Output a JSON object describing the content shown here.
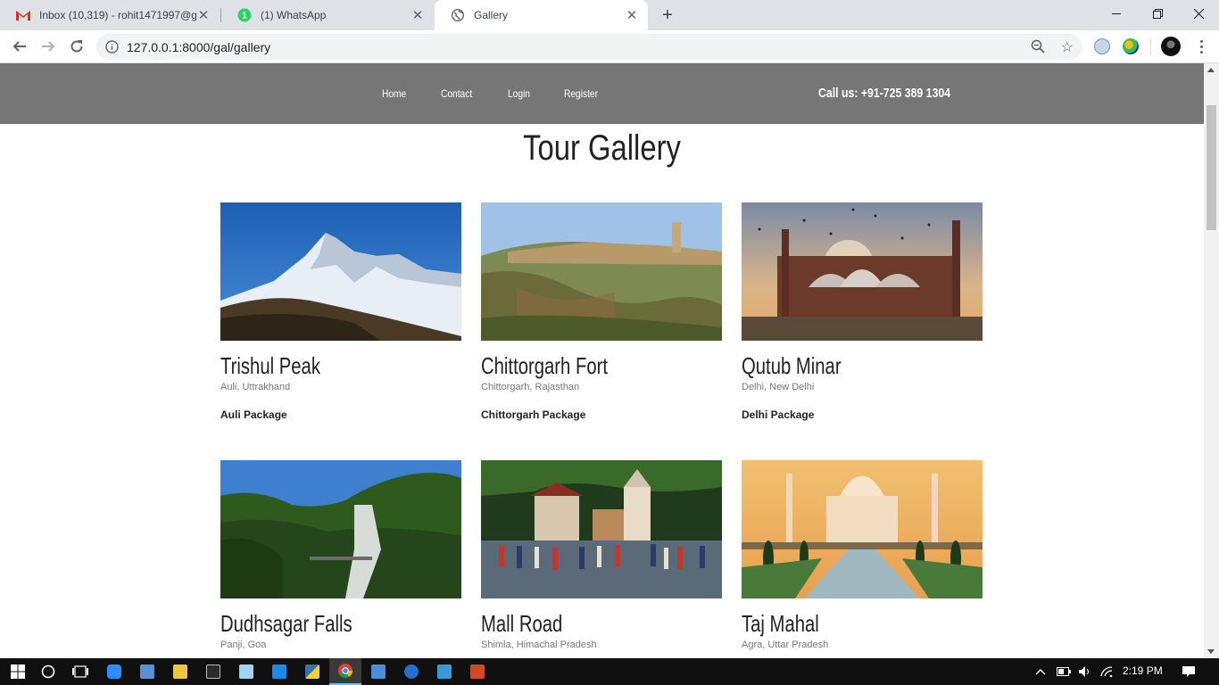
{
  "browser": {
    "tabs": [
      {
        "title": "Inbox (10,319) - rohit1471997@g",
        "icon": "gmail-icon"
      },
      {
        "title": "(1) WhatsApp",
        "icon": "whatsapp-icon",
        "badge": "1"
      },
      {
        "title": "Gallery",
        "icon": "globe-icon",
        "active": true
      }
    ],
    "url": "127.0.0.1:8000/gal/gallery"
  },
  "site": {
    "nav": {
      "items": [
        "Home",
        "Contact",
        "Login",
        "Register"
      ],
      "call": "Call us: +91-725 389 1304"
    },
    "title": "Tour Gallery",
    "cards": [
      {
        "name": "Trishul Peak",
        "location": "Auli, Uttrakhand",
        "package": "Auli Package"
      },
      {
        "name": "Chittorgarh Fort",
        "location": "Chittorgarh, Rajasthan",
        "package": "Chittorgarh Package"
      },
      {
        "name": "Qutub Minar",
        "location": "Delhi, New Delhi",
        "package": "Delhi Package"
      },
      {
        "name": "Dudhsagar Falls",
        "location": "Panji, Goa",
        "package": ""
      },
      {
        "name": "Mall Road",
        "location": "Shimla, Himachal Pradesh",
        "package": ""
      },
      {
        "name": "Taj Mahal",
        "location": "Agra, Uttar Pradesh",
        "package": ""
      }
    ]
  },
  "taskbar": {
    "clock": "2:19 PM"
  },
  "colors": {
    "nav_bg": "#767676",
    "tabbar_bg": "#dee1e6",
    "taskbar_bg": "#101010"
  }
}
